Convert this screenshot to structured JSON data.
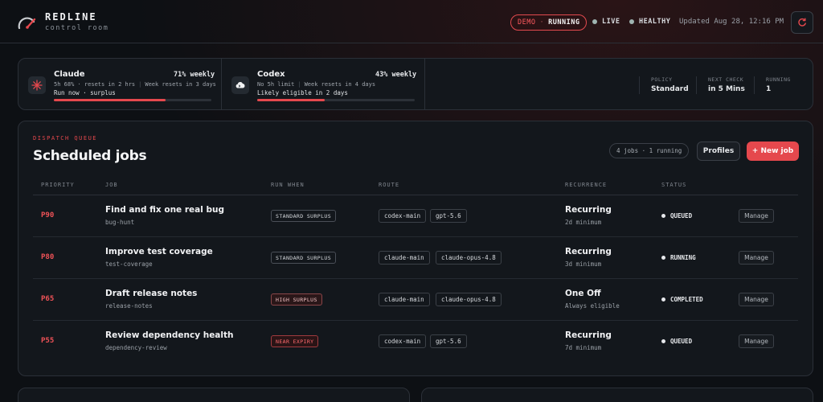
{
  "app": {
    "title": "REDLINE",
    "subtitle": "control room"
  },
  "header": {
    "mode": "DEMO",
    "mode_sep": "·",
    "mode_state": "RUNNING",
    "live_label": "LIVE",
    "health_label": "HEALTHY",
    "updated_text": "Updated Aug 28, 12:16 PM",
    "colors": {
      "live": "#9fb4b1",
      "healthy": "#9fb4b1",
      "accent": "#e5484d"
    },
    "refresh_icon": "refresh-icon"
  },
  "usage": {
    "meters": [
      {
        "name": "Claude",
        "weekly": "71% weekly",
        "detail_a": "5h 68% · resets in 2 hrs",
        "detail_b": "Week resets in 3 days",
        "note": "Run now · surplus",
        "progress": 0.71,
        "icon": "burst-icon"
      },
      {
        "name": "Codex",
        "weekly": "43% weekly",
        "detail_a": "No 5h limit",
        "detail_b": "Week resets in 4 days",
        "note": "Likely eligible in 2 days",
        "progress": 0.43,
        "icon": "cloud-icon"
      }
    ],
    "stats": [
      {
        "label": "POLICY",
        "value": "Standard"
      },
      {
        "label": "NEXT CHECK",
        "value": "in 5 Mins"
      },
      {
        "label": "RUNNING",
        "value": "1"
      }
    ]
  },
  "queue": {
    "eyebrow": "DISPATCH QUEUE",
    "title": "Scheduled jobs",
    "count_text": "4 jobs · 1 running",
    "profiles_label": "Profiles",
    "new_job_label": "+ New job",
    "columns": [
      "PRIORITY",
      "JOB",
      "RUN WHEN",
      "ROUTE",
      "RECURRENCE",
      "STATUS"
    ],
    "rows": [
      {
        "priority": "P90",
        "title": "Find and fix one real bug",
        "slug": "bug-hunt",
        "run_when": "STANDARD SURPLUS",
        "route": [
          "codex-main",
          "gpt-5.6"
        ],
        "recurrence": "Recurring",
        "recurrence_sub": "2d minimum",
        "status": "QUEUED",
        "manage_label": "Manage"
      },
      {
        "priority": "P80",
        "title": "Improve test coverage",
        "slug": "test-coverage",
        "run_when": "STANDARD SURPLUS",
        "route": [
          "claude-main",
          "claude-opus-4.8"
        ],
        "recurrence": "Recurring",
        "recurrence_sub": "3d minimum",
        "status": "RUNNING",
        "manage_label": "Manage"
      },
      {
        "priority": "P65",
        "title": "Draft release notes",
        "slug": "release-notes",
        "run_when": "HIGH SURPLUS",
        "route": [
          "claude-main",
          "claude-opus-4.8"
        ],
        "recurrence": "One Off",
        "recurrence_sub": "Always eligible",
        "status": "COMPLETED",
        "manage_label": "Manage"
      },
      {
        "priority": "P55",
        "title": "Review dependency health",
        "slug": "dependency-review",
        "run_when": "NEAR EXPIRY",
        "route": [
          "codex-main",
          "gpt-5.6"
        ],
        "recurrence": "Recurring",
        "recurrence_sub": "7d minimum",
        "status": "QUEUED",
        "manage_label": "Manage"
      }
    ]
  }
}
